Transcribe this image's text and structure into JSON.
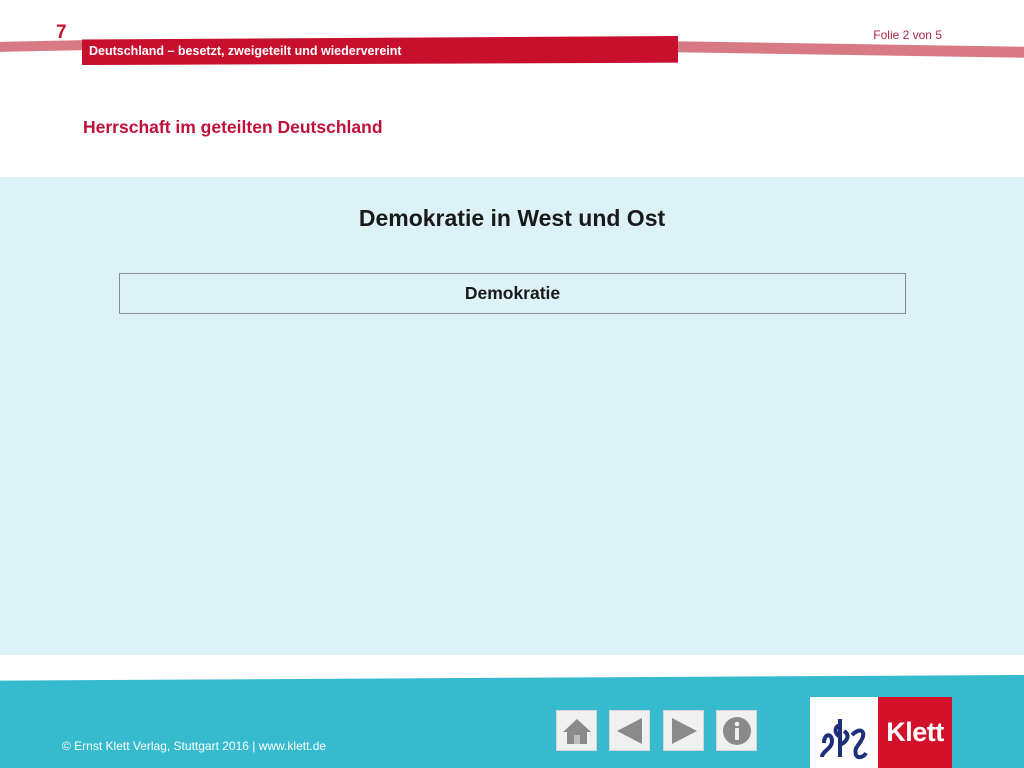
{
  "header": {
    "chapter_number": "7",
    "chapter_title": "Deutschland – besetzt, zweigeteilt und wiedervereint",
    "slide_counter": "Folie 2 von 5",
    "section_title": "Herrschaft im geteilten Deutschland"
  },
  "main": {
    "heading": "Demokratie in West und Ost",
    "concept_box": "Demokratie"
  },
  "footer": {
    "copyright": "© Ernst Klett Verlag, Stuttgart 2016 | www.klett.de",
    "nav": [
      {
        "name": "home",
        "icon": "home-icon"
      },
      {
        "name": "previous",
        "icon": "triangle-left-icon"
      },
      {
        "name": "next",
        "icon": "triangle-right-icon"
      },
      {
        "name": "info",
        "icon": "info-icon"
      }
    ],
    "logo_text": "Klett"
  },
  "colors": {
    "brand_red": "#c8102e",
    "content_background": "#dcf2f7",
    "footer_teal": "#35bace"
  }
}
